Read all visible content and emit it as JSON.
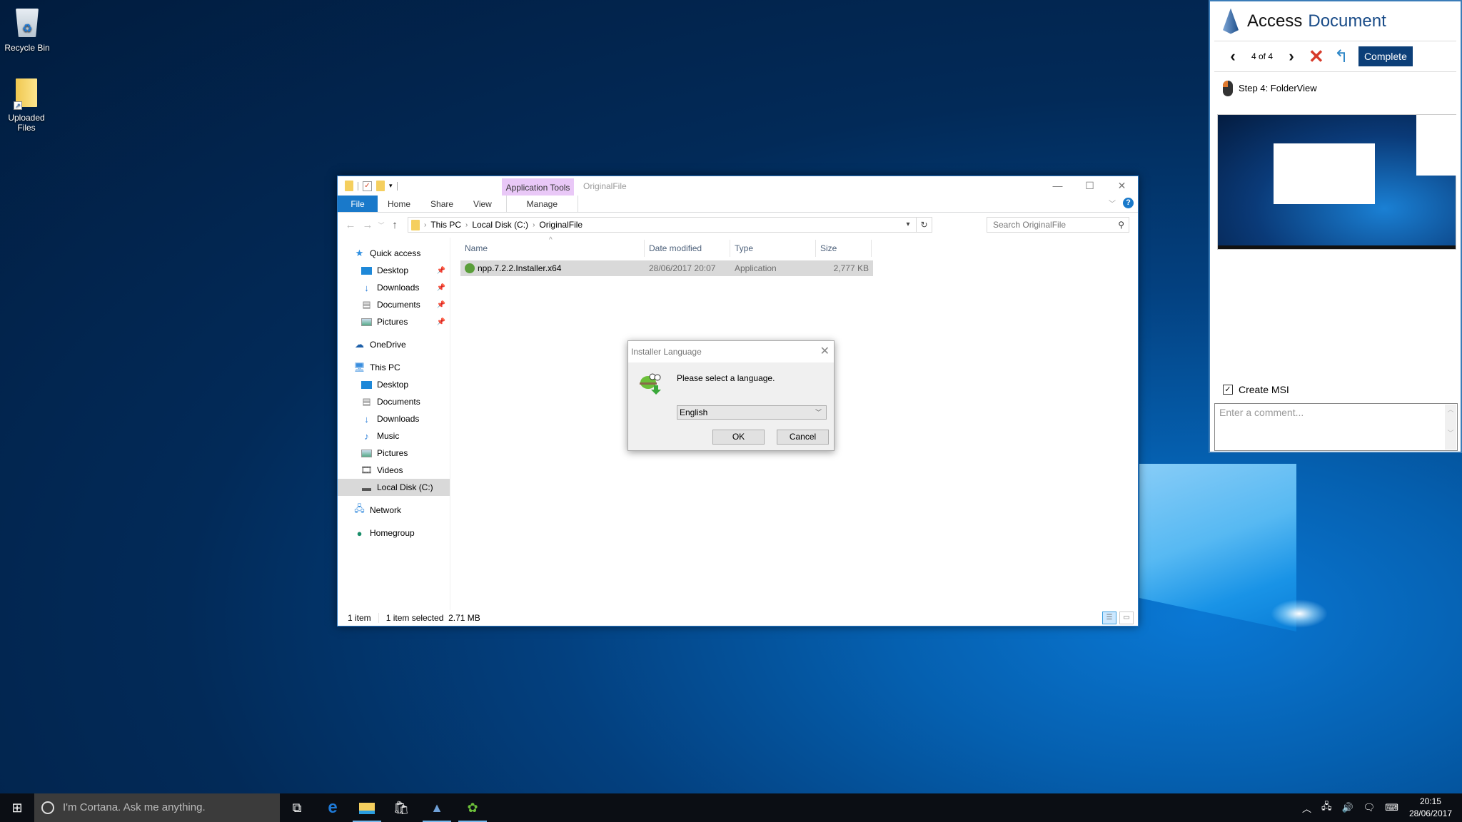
{
  "desktop": {
    "icons": [
      {
        "label": "Recycle Bin",
        "icon": "recycle-bin-icon"
      },
      {
        "label": "Uploaded Files",
        "icon": "folder-shortcut-icon"
      }
    ]
  },
  "explorer": {
    "window_title": "OriginalFile",
    "contextual_tab_group": "Application Tools",
    "ribbon_tabs": [
      "File",
      "Home",
      "Share",
      "View",
      "Manage"
    ],
    "address_crumbs": [
      "This PC",
      "Local Disk (C:)",
      "OriginalFile"
    ],
    "search_placeholder": "Search OriginalFile",
    "nav": {
      "quick_access": "Quick access",
      "quick_items": [
        "Desktop",
        "Downloads",
        "Documents",
        "Pictures"
      ],
      "onedrive": "OneDrive",
      "this_pc": "This PC",
      "pc_items": [
        "Desktop",
        "Documents",
        "Downloads",
        "Music",
        "Pictures",
        "Videos",
        "Local Disk (C:)"
      ],
      "network": "Network",
      "homegroup": "Homegroup"
    },
    "columns": [
      "Name",
      "Date modified",
      "Type",
      "Size"
    ],
    "files": [
      {
        "name": "npp.7.2.2.Installer.x64",
        "date": "28/06/2017 20:07",
        "type": "Application",
        "size": "2,777 KB"
      }
    ],
    "status": {
      "count": "1 item",
      "selected": "1 item selected  2.71 MB"
    }
  },
  "dialog": {
    "title": "Installer Language",
    "message": "Please select a language.",
    "selected_language": "English",
    "ok_label": "OK",
    "cancel_label": "Cancel"
  },
  "panel": {
    "title_part1": "Access",
    "title_part2": "Document",
    "step_counter": "4 of 4",
    "complete_label": "Complete",
    "step_label": "Step 4: FolderView",
    "create_msi_label": "Create MSI",
    "create_msi_checked": true,
    "comment_placeholder": "Enter a comment..."
  },
  "taskbar": {
    "cortana_placeholder": "I'm Cortana. Ask me anything.",
    "time": "20:15",
    "date": "28/06/2017"
  },
  "colors": {
    "accent": "#1979ca",
    "complete_button": "#0c3f78",
    "contextual_tab": "#e9c8f7",
    "cancel_x": "#d73a2a"
  }
}
